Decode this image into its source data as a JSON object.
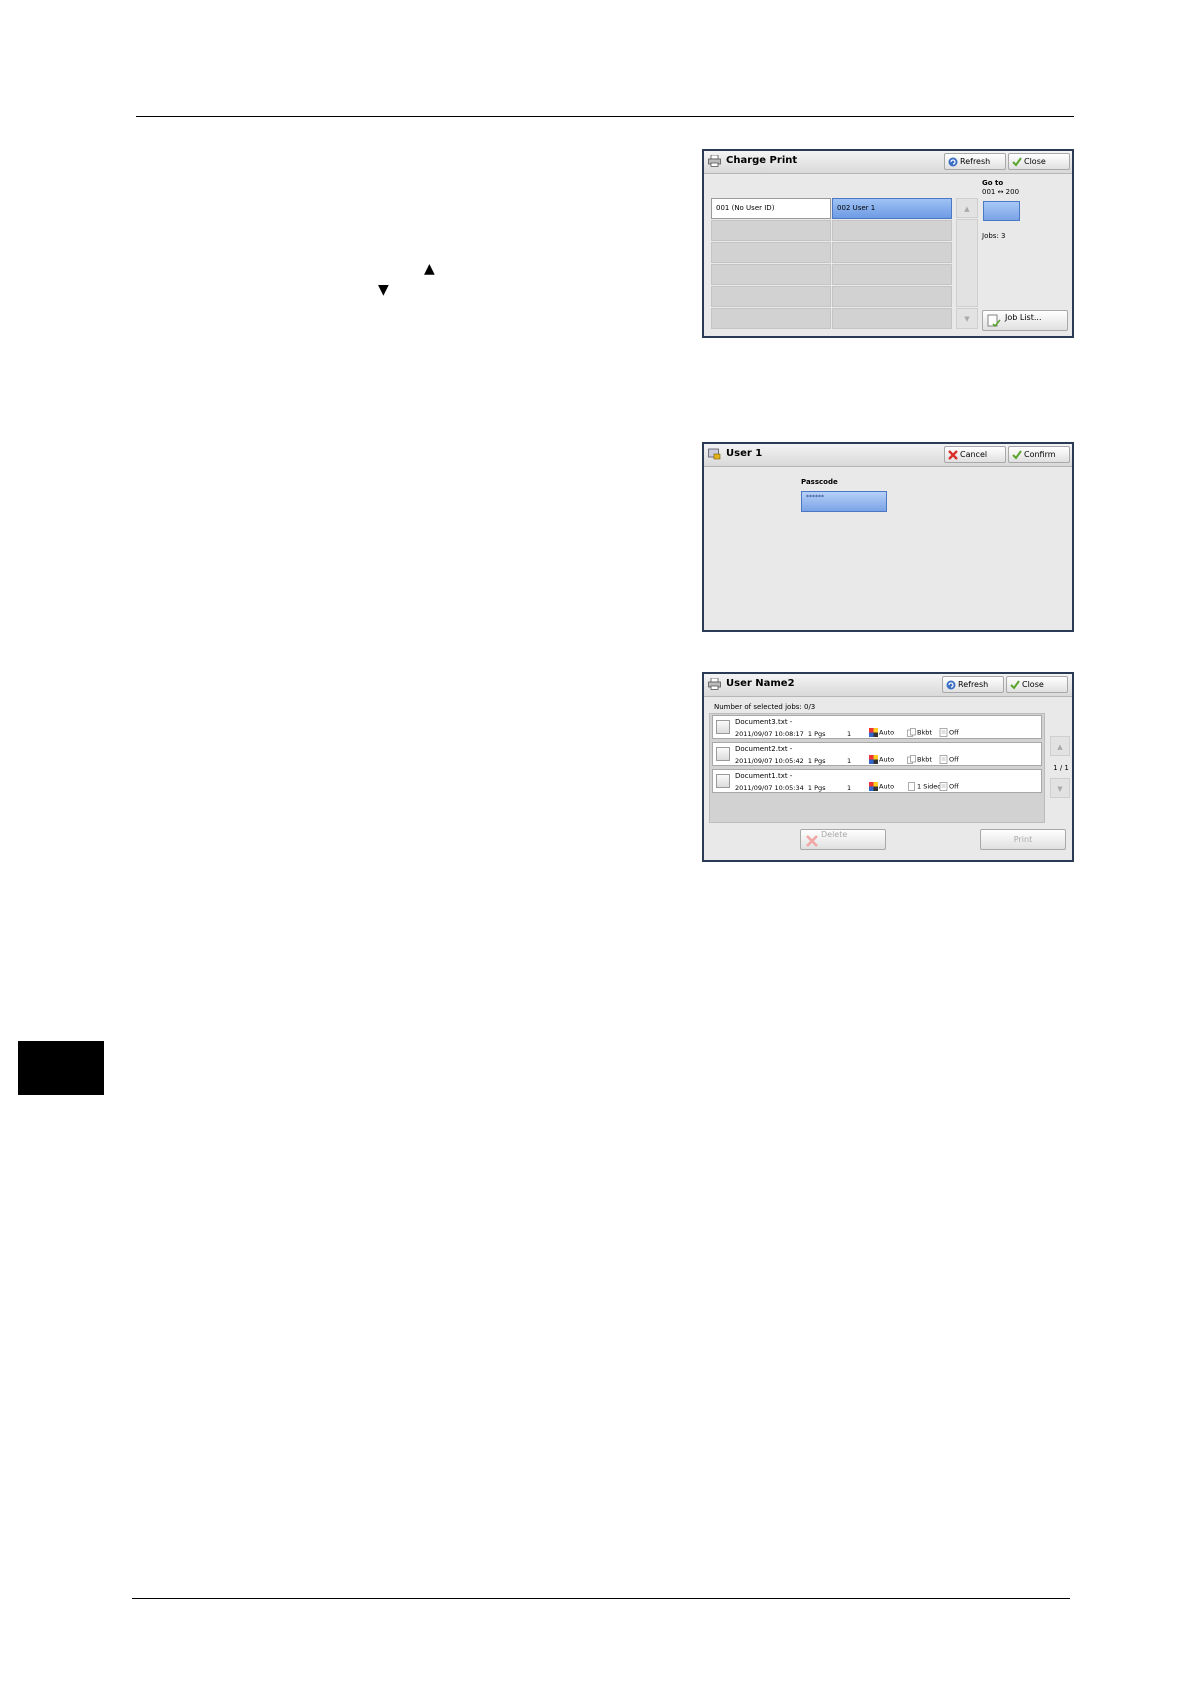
{
  "charge_print": {
    "title": "Charge Print",
    "refresh": "Refresh",
    "close": "Close",
    "goto_label": "Go to",
    "goto_range": "001 ↔ 200",
    "jobs": "Jobs: 3",
    "job_list": "Job List...",
    "users": [
      "001 (No User ID)",
      "002 User 1"
    ]
  },
  "user1": {
    "title": "User 1",
    "cancel": "Cancel",
    "confirm": "Confirm",
    "passcode_label": "Passcode",
    "passcode_value": "******"
  },
  "user_name2": {
    "title": "User Name2",
    "refresh": "Refresh",
    "close": "Close",
    "selected": "Number of selected jobs: 0/3",
    "page": "1 / 1",
    "delete": "Delete",
    "print": "Print",
    "jobs": [
      {
        "name": "Document3.txt -",
        "date": "2011/09/07 10:08:17",
        "pages": "1 Pgs",
        "qty": "1",
        "color": "Auto",
        "sides": "Bkbt",
        "staple": "Off"
      },
      {
        "name": "Document2.txt -",
        "date": "2011/09/07 10:05:42",
        "pages": "1 Pgs",
        "qty": "1",
        "color": "Auto",
        "sides": "Bkbt",
        "staple": "Off"
      },
      {
        "name": "Document1.txt -",
        "date": "2011/09/07 10:05:34",
        "pages": "1 Pgs",
        "qty": "1",
        "color": "Auto",
        "sides": "1 Sided",
        "staple": "Off"
      }
    ]
  },
  "colors": {
    "selection_blue": "#7fa9ec",
    "frame": "#2b3a55",
    "panel_bg": "#e9e9e9"
  }
}
